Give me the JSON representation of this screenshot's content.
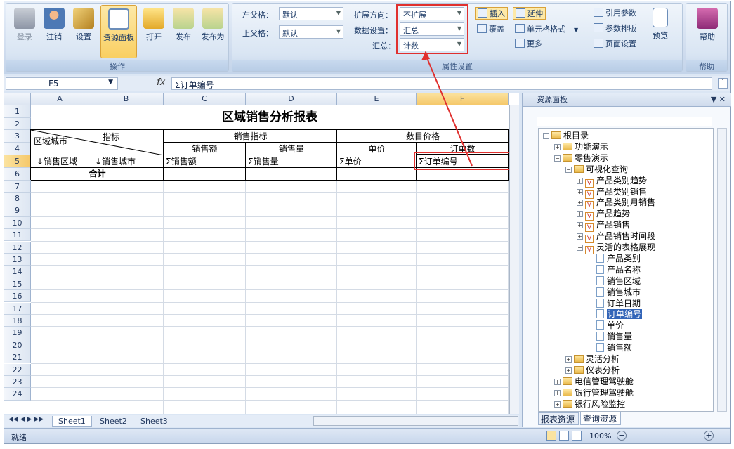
{
  "ribbon": {
    "buttons": [
      {
        "label": "登录",
        "disabled": true
      },
      {
        "label": "注销"
      },
      {
        "label": "设置"
      },
      {
        "label": "资源面板",
        "active": true
      },
      {
        "label": "打开"
      },
      {
        "label": "发布"
      },
      {
        "label": "发布为"
      }
    ],
    "group_ops": "操作",
    "left_parent_label": "左父格：",
    "left_parent_value": "默认",
    "top_parent_label": "上父格：",
    "top_parent_value": "默认",
    "expand_dir_label": "扩展方向：",
    "expand_dir_value": "不扩展",
    "data_setting_label": "数据设置：",
    "data_setting_value": "汇总",
    "summary_label": "汇总：",
    "summary_value": "计数",
    "insert": "插入",
    "extend": "延伸",
    "overwrite": "覆盖",
    "cell_format": "单元格格式",
    "more": "更多",
    "ref_param": "引用参数",
    "param_layout": "参数排版",
    "page_setup": "页面设置",
    "preview": "预览",
    "group_props": "属性设置",
    "help": "帮助",
    "group_help": "帮助"
  },
  "formula": {
    "cell_ref": "F5",
    "fx": "fx",
    "content": "Σ订单编号"
  },
  "grid": {
    "columns": [
      "A",
      "B",
      "C",
      "D",
      "E",
      "F"
    ],
    "rows": [
      "1",
      "2",
      "3",
      "4",
      "5",
      "6",
      "7",
      "8",
      "9",
      "10",
      "11",
      "12",
      "13",
      "14",
      "15",
      "16",
      "17",
      "18",
      "19",
      "20",
      "21",
      "22",
      "23",
      "24"
    ],
    "title": "区域销售分析报表",
    "hdr_region_city": "区域城市",
    "hdr_indicator": "指标",
    "hdr_sales_ind": "销售指标",
    "hdr_price": "数目价格",
    "hdr_sales_amount": "销售额",
    "hdr_sales_qty": "销售量",
    "hdr_unit_price": "单价",
    "hdr_order_count": "订单数",
    "r5": [
      "↓销售区域",
      "↓销售城市",
      "Σ销售额",
      "Σ销售量",
      "Σ单价",
      "Σ订单编号"
    ],
    "total": "合计"
  },
  "sheets": [
    "Sheet1",
    "Sheet2",
    "Sheet3"
  ],
  "status": {
    "ready": "就绪",
    "zoom": "100%"
  },
  "panel": {
    "title": "资源面板",
    "tree": [
      {
        "label": "根目录",
        "lvl": 0,
        "type": "folder",
        "pm": "-"
      },
      {
        "label": "功能演示",
        "lvl": 1,
        "type": "folder",
        "pm": "+"
      },
      {
        "label": "零售演示",
        "lvl": 1,
        "type": "folder",
        "pm": "-"
      },
      {
        "label": "可视化查询",
        "lvl": 2,
        "type": "folder",
        "pm": "-"
      },
      {
        "label": "产品类别趋势",
        "lvl": 3,
        "type": "viz",
        "pm": "+"
      },
      {
        "label": "产品类别销售",
        "lvl": 3,
        "type": "viz",
        "pm": "+"
      },
      {
        "label": "产品类别月销售",
        "lvl": 3,
        "type": "viz",
        "pm": "+"
      },
      {
        "label": "产品趋势",
        "lvl": 3,
        "type": "viz",
        "pm": "+"
      },
      {
        "label": "产品销售",
        "lvl": 3,
        "type": "viz",
        "pm": "+"
      },
      {
        "label": "产品销售时间段",
        "lvl": 3,
        "type": "viz",
        "pm": "+"
      },
      {
        "label": "灵活的表格展现",
        "lvl": 3,
        "type": "viz",
        "pm": "-"
      },
      {
        "label": "产品类别",
        "lvl": 4,
        "type": "field"
      },
      {
        "label": "产品名称",
        "lvl": 4,
        "type": "field"
      },
      {
        "label": "销售区域",
        "lvl": 4,
        "type": "field"
      },
      {
        "label": "销售城市",
        "lvl": 4,
        "type": "field"
      },
      {
        "label": "订单日期",
        "lvl": 4,
        "type": "field"
      },
      {
        "label": "订单编号",
        "lvl": 4,
        "type": "field",
        "hl": true
      },
      {
        "label": "单价",
        "lvl": 4,
        "type": "field"
      },
      {
        "label": "销售量",
        "lvl": 4,
        "type": "field"
      },
      {
        "label": "销售额",
        "lvl": 4,
        "type": "field"
      },
      {
        "label": "灵活分析",
        "lvl": 2,
        "type": "folder",
        "pm": "+"
      },
      {
        "label": "仪表分析",
        "lvl": 2,
        "type": "folder",
        "pm": "+"
      },
      {
        "label": "电信管理驾驶舱",
        "lvl": 1,
        "type": "folder",
        "pm": "+"
      },
      {
        "label": "银行管理驾驶舱",
        "lvl": 1,
        "type": "folder",
        "pm": "+"
      },
      {
        "label": "银行风险监控",
        "lvl": 1,
        "type": "folder",
        "pm": "+"
      }
    ],
    "tabs": [
      "报表资源",
      "查询资源"
    ]
  },
  "colors": {
    "accent": "#e0302e",
    "highlight": "#3365b8"
  }
}
